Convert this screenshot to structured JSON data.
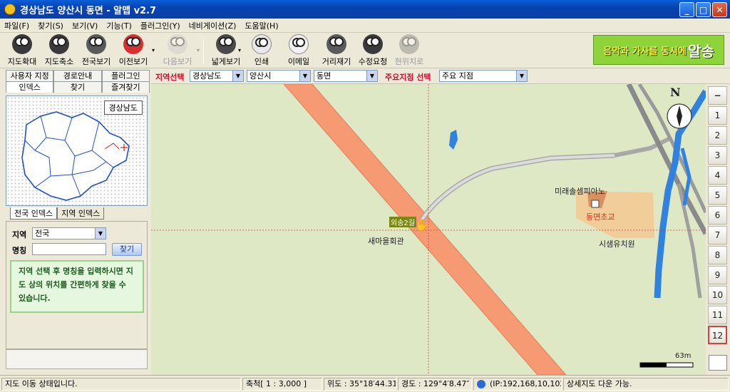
{
  "window": {
    "title": "경상남도 양산시 동면 - 알맵 v2.7",
    "min": "_",
    "max": "□",
    "close": "✕"
  },
  "menu": [
    "파일(F)",
    "찾기(S)",
    "보기(V)",
    "기능(T)",
    "플러그인(Y)",
    "네비게이션(Z)",
    "도움말(H)"
  ],
  "toolbar": {
    "zoom_in": "지도확대",
    "zoom_out": "지도축소",
    "full_view": "전국보기",
    "prev_view": "이전보기",
    "next_view": "다음보기",
    "wide_view": "넓게보기",
    "print": "인쇄",
    "email": "이메일",
    "measure": "거리재기",
    "correction": "수정요청",
    "current_loc": "현위치로",
    "banner_text": "음악과 가사를 동시에",
    "banner_brand": "알송"
  },
  "left_tabs_row1": [
    "사용자 지정",
    "경로안내",
    "플러그인"
  ],
  "left_tabs_row2": [
    "인덱스",
    "찾기",
    "즐겨찾기"
  ],
  "minimap": {
    "region_label": "경상남도"
  },
  "minimap_tabs": [
    "전국 인덱스",
    "지역 인덱스"
  ],
  "search": {
    "region_label": "지역",
    "region_value": "전국",
    "name_label": "명칭",
    "name_value": "",
    "find_button": "찾기",
    "tip": "지역 선택 후 명칭을 입력하시면 지도 상의 위치를 간편하게 찾을 수 있습니다."
  },
  "selectors": {
    "region_select_label": "지역선택",
    "province": "경상남도",
    "city": "양산시",
    "town": "동면",
    "poi_label": "주요지점 선택",
    "poi_value": "주요 지점"
  },
  "map": {
    "labels": {
      "village_hall": "새마을회관",
      "road_tag": "외송2길",
      "piano": "미래솔셈피아노",
      "school": "동면초교",
      "kindergarten": "시샘유치원"
    },
    "compass": "N",
    "scale_text": "63m",
    "colors": {
      "background": "#dfe8c5",
      "main_road": "#f59a72",
      "river": "#2f82e0",
      "side_road": "#c9c9c9",
      "school_area": "#f4c890"
    }
  },
  "zoom": {
    "minus": "−",
    "levels": [
      "1",
      "2",
      "3",
      "4",
      "5",
      "6",
      "7",
      "8",
      "9",
      "10",
      "11",
      "12"
    ],
    "active": "12"
  },
  "status": {
    "state": "지도 이동 상태입니다.",
    "scale": "축척[ 1 : 3,000 ]",
    "lat": "위도 : 35°18′44.31″",
    "lon": "경도 : 129°4′8.47″",
    "ip": "(IP:192,168,10,102)",
    "detail": "상세지도 다운 가능."
  }
}
